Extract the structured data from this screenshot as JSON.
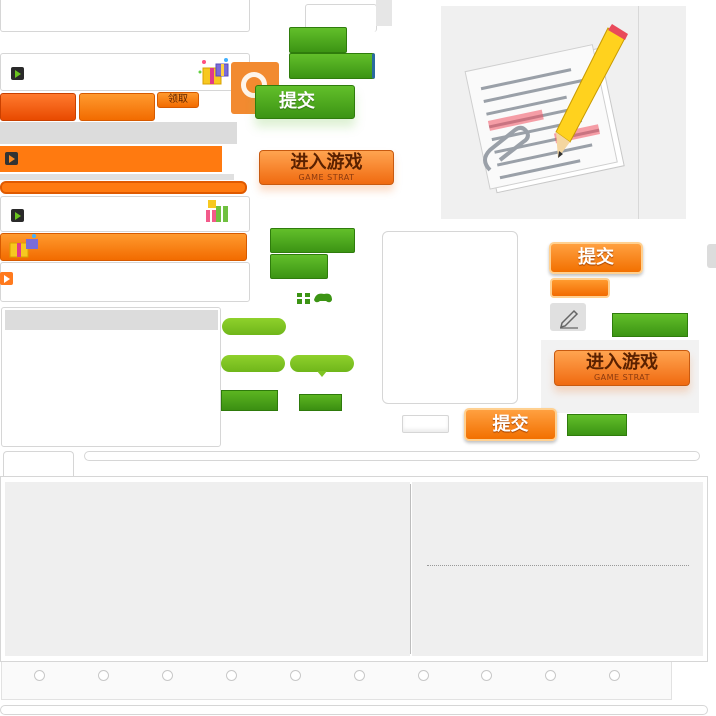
{
  "buttons": {
    "claim_label": "领取",
    "submit_label": "提交",
    "enter_game_label": "进入游戏",
    "enter_game_sub": "GAME STRAT"
  },
  "colors": {
    "orange": "#f27000",
    "green": "#3c9414",
    "lime": "#7fc423",
    "panel_grey": "#efefef",
    "border_grey": "#d6d6d6"
  },
  "icons": [
    "arrow-right-icon",
    "gift-icon",
    "gamepad-icon",
    "pencil-icon",
    "document-icon",
    "paperclip-icon"
  ]
}
